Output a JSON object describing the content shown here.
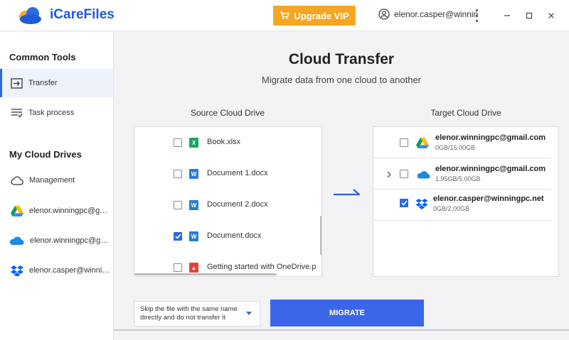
{
  "app": {
    "title": "iCareFiles"
  },
  "header": {
    "vip_label": "Upgrade VIP",
    "user_email": "elenor.casper@winnin"
  },
  "sidebar": {
    "section_tools": "Common Tools",
    "tools": [
      {
        "label": "Transfer",
        "icon": "transfer-icon",
        "active": true
      },
      {
        "label": "Task process",
        "icon": "task-list-icon",
        "active": false
      }
    ],
    "section_drives": "My Cloud Drives",
    "drives": [
      {
        "label": "Management",
        "icon": "cloud-outline-icon"
      },
      {
        "label": "elenor.winningpc@gm...",
        "icon": "google-drive-icon"
      },
      {
        "label": "elenor.winningpc@gma...",
        "icon": "onedrive-icon"
      },
      {
        "label": "elenor.casper@winning...",
        "icon": "dropbox-icon"
      }
    ]
  },
  "main": {
    "title": "Cloud Transfer",
    "subtitle": "Migrate data from one cloud to another",
    "source_label": "Source Cloud Drive",
    "target_label": "Target Cloud Drive"
  },
  "source_files": [
    {
      "name": "Book.xlsx",
      "type": "excel",
      "checked": false
    },
    {
      "name": "Document 1.docx",
      "type": "word",
      "checked": false
    },
    {
      "name": "Document 2.docx",
      "type": "word",
      "checked": false
    },
    {
      "name": "Document.docx",
      "type": "word",
      "checked": true
    },
    {
      "name": "Getting started with OneDrive.p",
      "type": "pdf",
      "checked": false
    }
  ],
  "target_drives": [
    {
      "email": "elenor.winningpc@gmail.com",
      "capacity": "0GB/15.00GB",
      "service": "google-drive-icon",
      "checked": false,
      "expandable": false
    },
    {
      "email": "elenor.winningpc@gmail.com",
      "capacity": "1.95GB/5.00GB",
      "service": "onedrive-icon",
      "checked": false,
      "expandable": true
    },
    {
      "email": "elenor.casper@winningpc.net",
      "capacity": "0GB/2.00GB",
      "service": "dropbox-icon",
      "checked": true,
      "expandable": false
    }
  ],
  "footer": {
    "skip_option": "Skip the file with the same name directly and do not transfer it",
    "migrate_label": "MIGRATE"
  },
  "colors": {
    "accent": "#3c66ea",
    "vip": "#f5a623",
    "brand": "#1e5adc"
  }
}
